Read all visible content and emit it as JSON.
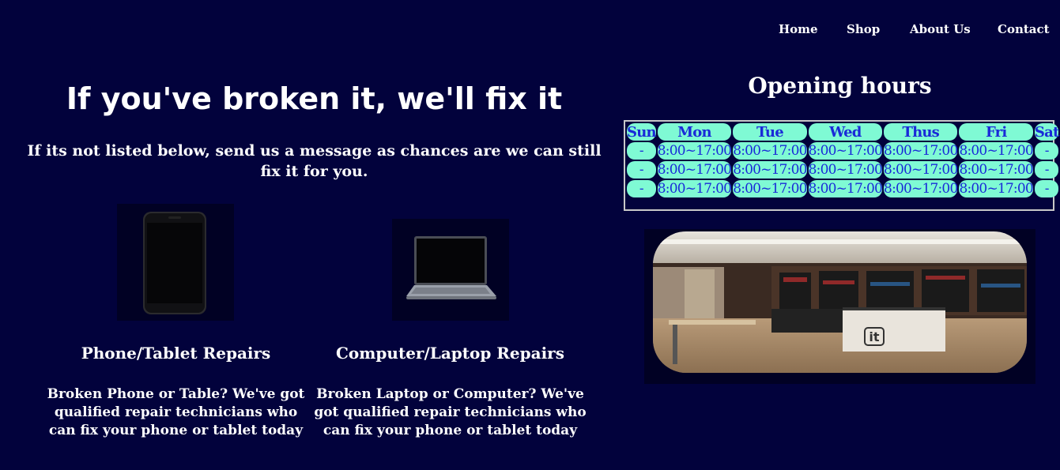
{
  "nav": {
    "items": [
      "Home",
      "Shop",
      "About Us",
      "Contact"
    ]
  },
  "hero": {
    "title": "If you've broken it, we'll fix it",
    "subtitle": "If its not listed below, send us a message as chances are we can still fix it for you."
  },
  "services": [
    {
      "icon": "smartphone-icon",
      "title": "Phone/Tablet Repairs",
      "description": "Broken Phone or Table? We've got qualified repair technicians who can fix your phone or tablet today"
    },
    {
      "icon": "laptop-icon",
      "title": "Computer/Laptop Repairs",
      "description": "Broken Laptop or Computer? We've got qualified repair technicians who can fix your phone or tablet today"
    }
  ],
  "hours": {
    "title": "Opening hours",
    "days": [
      "Sun",
      "Mon",
      "Tue",
      "Wed",
      "Thus",
      "Fri",
      "Sat"
    ],
    "rows": [
      [
        "-",
        "8:00~17:00",
        "8:00~17:00",
        "8:00~17:00",
        "8:00~17:00",
        "8:00~17:00",
        "-"
      ],
      [
        "-",
        "8:00~17:00",
        "8:00~17:00",
        "8:00~17:00",
        "8:00~17:00",
        "8:00~17:00",
        "-"
      ],
      [
        "-",
        "8:00~17:00",
        "8:00~17:00",
        "8:00~17:00",
        "8:00~17:00",
        "8:00~17:00",
        "-"
      ]
    ]
  },
  "store_photo": {
    "sign_text": "it"
  },
  "colors": {
    "background": "#02023c",
    "cell_bg": "#7ffad4",
    "cell_text": "#1a2ad8"
  }
}
